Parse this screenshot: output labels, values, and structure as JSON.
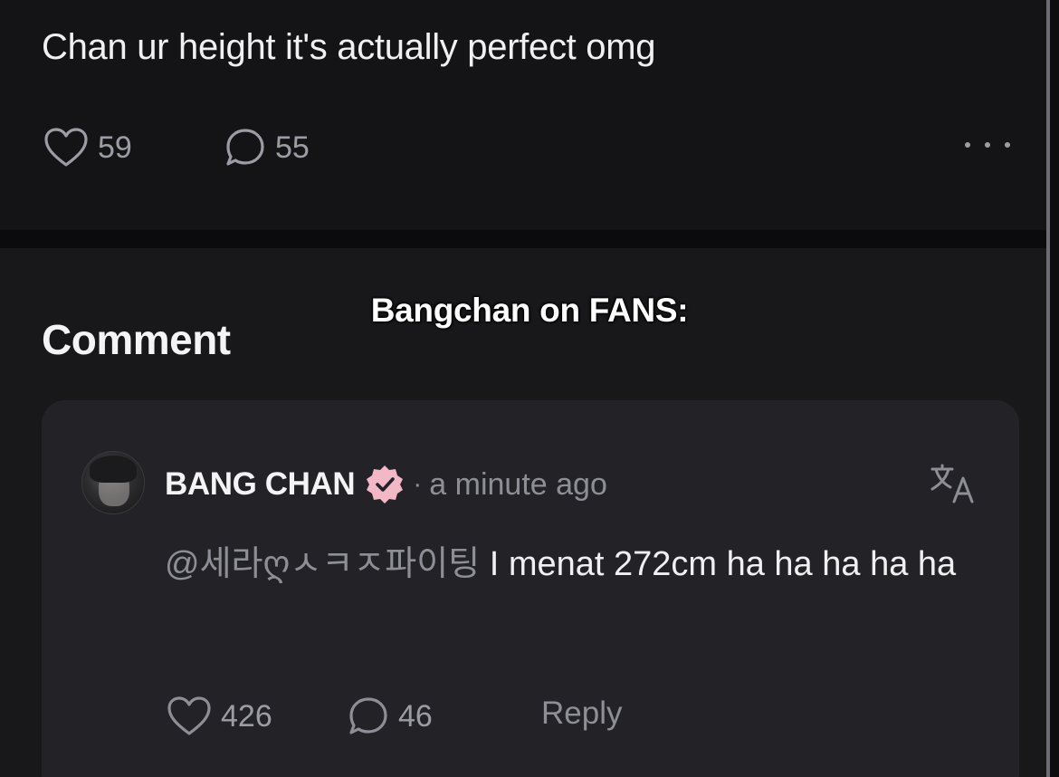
{
  "post": {
    "text": "Chan ur height it's actually perfect omg",
    "likes": "59",
    "comments": "55",
    "like_icon": "heart-icon",
    "comment_icon": "speech-bubble-icon",
    "more_icon": "more-dots-icon"
  },
  "section": {
    "heading": "Comment"
  },
  "caption": "Bangchan on FANS:",
  "comment": {
    "author": "BANG CHAN",
    "verified_icon": "verified-badge-icon",
    "separator": "·",
    "time": "a minute ago",
    "translate_icon": "translate-icon",
    "mention": "@세라ღㅅㅋㅈ파이팅",
    "text": " I menat 272cm ha ha ha ha ha",
    "likes": "426",
    "replies": "46",
    "reply_label": "Reply"
  },
  "colors": {
    "background": "#18181b",
    "card": "#232327",
    "muted_text": "#8e8e96",
    "verified_badge": "#f2b8c6"
  }
}
